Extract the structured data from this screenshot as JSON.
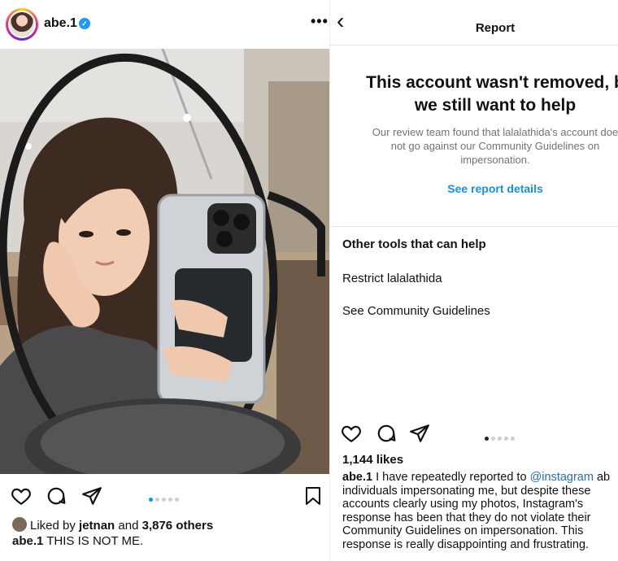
{
  "left_post": {
    "username": "abe.1",
    "more_label": "•••",
    "liked_by_prefix": "Liked by",
    "liked_by_user": "jetnan",
    "liked_by_and": "and",
    "liked_by_count": "3,876 others",
    "caption_user": "abe.1",
    "caption_text": "THIS IS NOT ME.",
    "carousel": {
      "total": 5,
      "active": 0
    }
  },
  "report": {
    "back_label": "‹",
    "title": "Report",
    "heading_line1": "This account wasn't removed, b",
    "heading_line2": "we still want to help",
    "body_line1": "Our review team found that lalalathida's account doe",
    "body_line2": "not go against our Community Guidelines on",
    "body_line3": "impersonation.",
    "details_link": "See report details",
    "tools_title": "Other tools that can help",
    "tools": [
      "Restrict lalalathida",
      "See Community Guidelines"
    ]
  },
  "right_post": {
    "likes": "1,144 likes",
    "caption_user": "abe.1",
    "caption_line1_text": "I have repeatedly reported to",
    "caption_mention": "@instagram",
    "caption_line1_tail": "ab",
    "caption_line2": "individuals impersonating me, but despite these",
    "caption_line3": "accounts clearly using my photos, Instagram's",
    "caption_line4": "response has been that they do not violate their",
    "caption_line5": "Community Guidelines on impersonation. This",
    "caption_line6": "response is really disappointing and frustrating.",
    "carousel": {
      "total": 5,
      "active": 0
    }
  },
  "colors": {
    "link_blue": "#1c8ce4",
    "carousel_active": "#0095f6",
    "verified": "#1d9bf0"
  },
  "icons": [
    "heart-icon",
    "comment-icon",
    "share-icon",
    "bookmark-icon",
    "verified-icon",
    "back-chevron-icon",
    "more-icon"
  ]
}
